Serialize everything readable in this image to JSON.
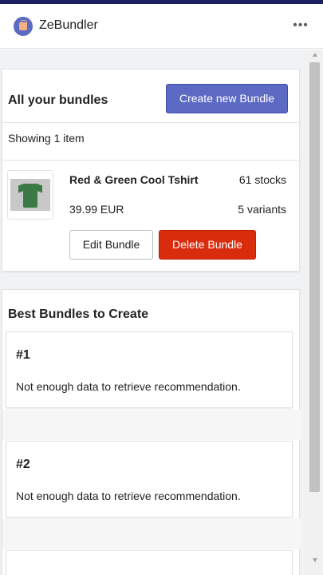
{
  "app": {
    "title": "ZeBundler",
    "logo_icon": "shopping-bag-icon",
    "more_label": "•••"
  },
  "colors": {
    "primary": "#5c6ac4",
    "destructive": "#d82c0d",
    "top_bar": "#1c2260"
  },
  "bundles": {
    "heading": "All your bundles",
    "create_button": "Create new Bundle",
    "showing_text": "Showing 1 item",
    "items": [
      {
        "name": "Red & Green Cool Tshirt",
        "stocks": "61 stocks",
        "price": "39.99 EUR",
        "variants": "5 variants",
        "thumbnail_icon": "green-tshirt-image",
        "edit_button": "Edit Bundle",
        "delete_button": "Delete Bundle"
      }
    ]
  },
  "best_bundles": {
    "heading": "Best Bundles to Create",
    "recommendations": [
      {
        "rank": "#1",
        "text": "Not enough data to retrieve recommendation."
      },
      {
        "rank": "#2",
        "text": "Not enough data to retrieve recommendation."
      }
    ]
  }
}
